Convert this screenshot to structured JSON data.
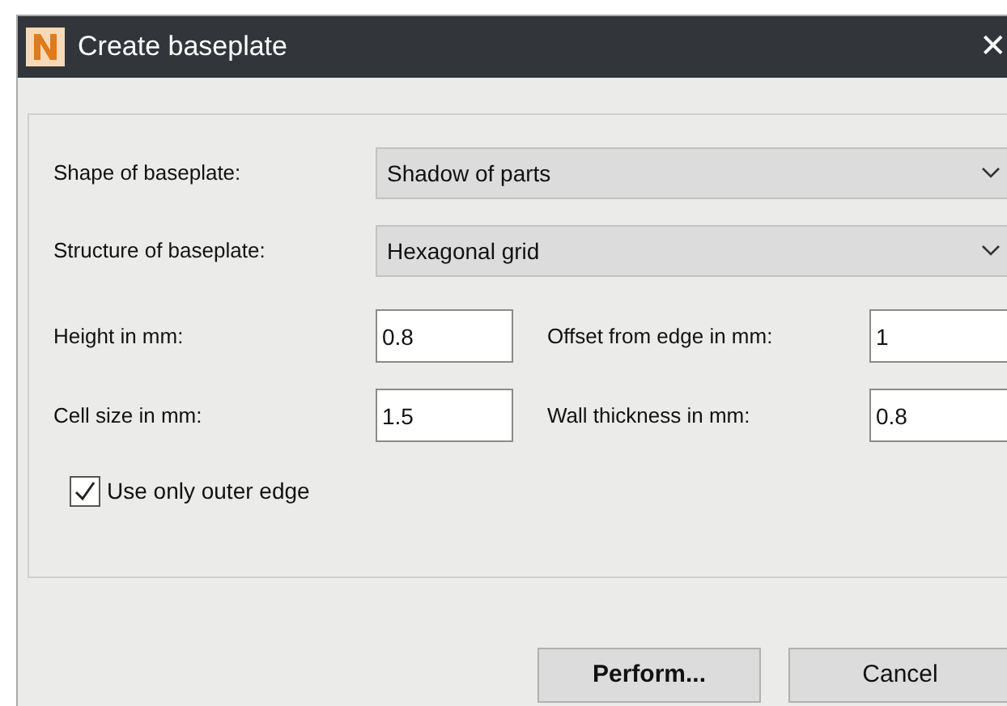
{
  "window": {
    "title": "Create baseplate",
    "close": "✕"
  },
  "dropdowns": [
    {
      "label": "Shape of baseplate:",
      "value": "Shadow of parts"
    },
    {
      "label": "Structure of baseplate:",
      "value": "Hexagonal grid"
    }
  ],
  "fields": [
    {
      "label": "Height in mm:",
      "value": "0.8"
    },
    {
      "label": "Offset from edge in mm:",
      "value": "1"
    },
    {
      "label": "Cell size in mm:",
      "value": "1.5"
    },
    {
      "label": "Wall thickness in mm:",
      "value": "0.8"
    }
  ],
  "checkbox": {
    "label": "Use only outer edge",
    "checked": true
  },
  "buttons": [
    {
      "label": "Perform...",
      "kind": "primary"
    },
    {
      "label": "Cancel",
      "kind": "normal"
    }
  ]
}
